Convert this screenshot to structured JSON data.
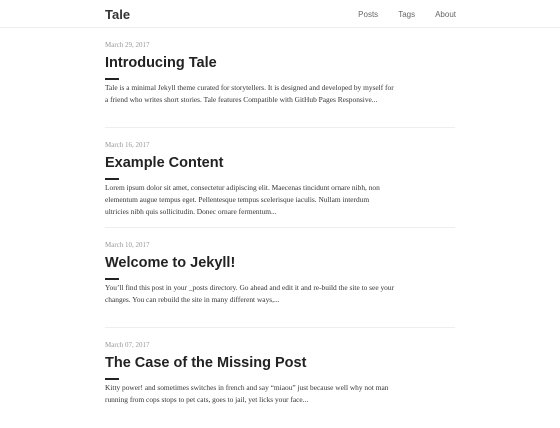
{
  "nav": {
    "title": "Tale",
    "links": [
      "Posts",
      "Tags",
      "About"
    ]
  },
  "posts": [
    {
      "date": "March 29, 2017",
      "title": "Introducing Tale",
      "excerpt": [
        "Tale is a minimal Jekyll theme curated for storytellers. It is designed and developed by myself for",
        "a friend who writes short stories. Tale features Compatible with GitHub Pages Responsive..."
      ]
    },
    {
      "date": "March 16, 2017",
      "title": "Example Content",
      "excerpt": [
        "Lorem ipsum dolor sit amet, consectetur adipiscing elit. Maecenas tincidunt ornare nibh, non",
        "elementum augue tempus eget. Pellentesque tempus scelerisque iaculis. Nullam interdum",
        "ultricies nibh quis sollicitudin. Donec ornare fermentum..."
      ]
    },
    {
      "date": "March 10, 2017",
      "title": "Welcome to Jekyll!",
      "excerpt": [
        "You’ll find this post in your _posts directory. Go ahead and edit it and re-build the site to see your",
        "changes. You can rebuild the site in many different ways,..."
      ]
    },
    {
      "date": "March 07, 2017",
      "title": "The Case of the Missing Post",
      "excerpt": [
        "Kitty power! and sometimes switches in french and say “miaou” just because well why not man",
        "running from cops stops to pet cats, goes to jail, yet licks your face..."
      ]
    }
  ]
}
